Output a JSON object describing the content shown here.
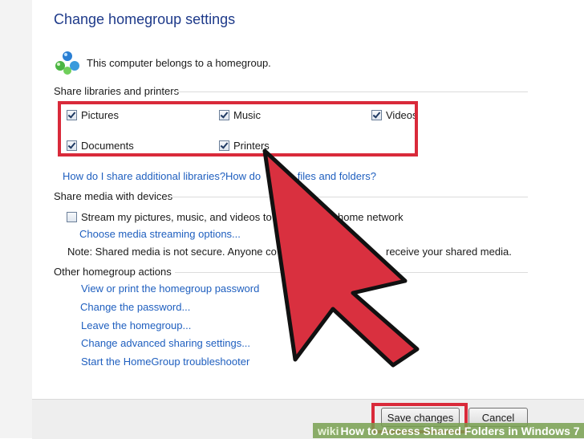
{
  "title": "Change homegroup settings",
  "status": "This computer belongs to a homegroup.",
  "sections": {
    "share_libraries": "Share libraries and printers",
    "share_media": "Share media with devices",
    "other_actions": "Other homegroup actions"
  },
  "libraries": [
    {
      "label": "Pictures",
      "checked": true
    },
    {
      "label": "Music",
      "checked": true
    },
    {
      "label": "Videos",
      "checked": true
    },
    {
      "label": "Documents",
      "checked": true
    },
    {
      "label": "Printers",
      "checked": true
    }
  ],
  "help_links": {
    "additional_libraries": "How do I share additional libraries?",
    "exclude_prefix": "How do",
    "exclude_suffix": "le files and folders?"
  },
  "media": {
    "stream_checkbox_left": "Stream my pictures, music, and videos to a",
    "stream_checkbox_right": "home network",
    "stream_checked": false,
    "streaming_options_link": "Choose media streaming options...",
    "note_left": "Note: Shared media is not secure. Anyone co",
    "note_right": "receive your shared media."
  },
  "actions": [
    "View or print the homegroup password",
    "Change the password...",
    "Leave the homegroup...",
    "Change advanced sharing settings...",
    "Start the HomeGroup troubleshooter"
  ],
  "buttons": {
    "save": "Save changes",
    "cancel": "Cancel"
  },
  "caption": {
    "brand": "wiki",
    "text": "How to Access Shared Folders in Windows 7"
  },
  "colors": {
    "highlight": "#d92a3a",
    "link": "#1f5fbf",
    "title": "#1e3a8a"
  }
}
